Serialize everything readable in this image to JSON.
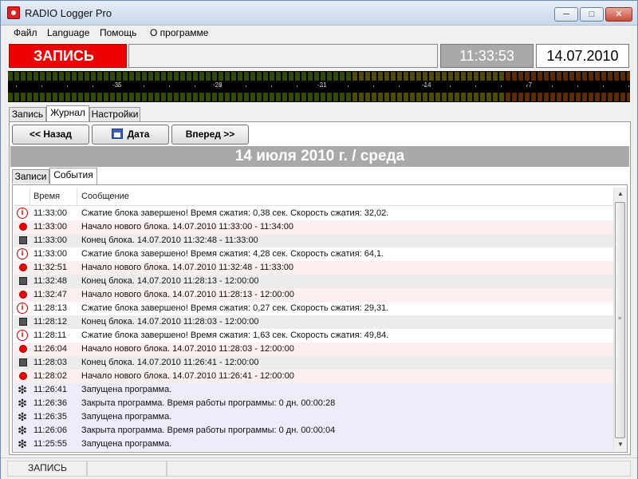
{
  "window": {
    "title": "RADIO Logger Pro"
  },
  "menu": [
    "Файл",
    "Language",
    "Помощь",
    "О программе"
  ],
  "status_strip": {
    "record_label": "ЗАПИСЬ",
    "time": "11:33:53",
    "date": "14.07.2010"
  },
  "meter": {
    "scale_labels": [
      "-35",
      "-28",
      "-21",
      "-14",
      "-7"
    ]
  },
  "top_tabs": [
    "Запись",
    "Журнал",
    "Настройки"
  ],
  "top_tabs_active": 1,
  "nav": {
    "back": "<< Назад",
    "date": "Дата",
    "forward": "Вперед >>"
  },
  "date_header": "14 июля 2010 г. / среда",
  "inner_tabs": [
    "Записи",
    "События"
  ],
  "inner_tabs_active": 1,
  "list": {
    "columns": [
      "Время",
      "Сообщение"
    ],
    "rows": [
      {
        "icon": "info-icon",
        "time": "11:33:00",
        "message": "Сжатие блока завершено! Время сжатия: 0,38 сек. Скорость сжатия: 32,02.",
        "bg": "#ffffff"
      },
      {
        "icon": "record-icon",
        "time": "11:33:00",
        "message": "Начало нового блока. 14.07.2010 11:33:00 - 11:34:00",
        "bg": "#fbefef"
      },
      {
        "icon": "stop-icon",
        "time": "11:33:00",
        "message": "Конец блока. 14.07.2010 11:32:48 - 11:33:00",
        "bg": "#ececec"
      },
      {
        "icon": "info-icon",
        "time": "11:33:00",
        "message": "Сжатие блока завершено! Время сжатия: 4,28 сек. Скорость сжатия: 64,1.",
        "bg": "#ffffff"
      },
      {
        "icon": "record-icon",
        "time": "11:32:51",
        "message": "Начало нового блока. 14.07.2010 11:32:48 - 11:33:00",
        "bg": "#fbefef"
      },
      {
        "icon": "stop-icon",
        "time": "11:32:48",
        "message": "Конец блока. 14.07.2010 11:28:13 - 12:00:00",
        "bg": "#ececec"
      },
      {
        "icon": "record-icon",
        "time": "11:32:47",
        "message": "Начало нового блока. 14.07.2010 11:28:13 - 12:00:00",
        "bg": "#fbefef"
      },
      {
        "icon": "info-icon",
        "time": "11:28:13",
        "message": "Сжатие блока завершено! Время сжатия: 0,27 сек. Скорость сжатия: 29,31.",
        "bg": "#ffffff"
      },
      {
        "icon": "stop-icon",
        "time": "11:28:12",
        "message": "Конец блока. 14.07.2010 11:28:03 - 12:00:00",
        "bg": "#ececec"
      },
      {
        "icon": "info-icon",
        "time": "11:28:11",
        "message": "Сжатие блока завершено! Время сжатия: 1,63 сек. Скорость сжатия: 49,84.",
        "bg": "#ffffff"
      },
      {
        "icon": "record-icon",
        "time": "11:26:04",
        "message": "Начало нового блока. 14.07.2010 11:28:03 - 12:00:00",
        "bg": "#fbefef"
      },
      {
        "icon": "stop-icon",
        "time": "11:28:03",
        "message": "Конец блока. 14.07.2010 11:26:41 - 12:00:00",
        "bg": "#ececec"
      },
      {
        "icon": "record-icon",
        "time": "11:28:02",
        "message": "Начало нового блока. 14.07.2010 11:26:41 - 12:00:00",
        "bg": "#fbefef"
      },
      {
        "icon": "program-icon",
        "time": "11:26:41",
        "message": "Запущена программа.",
        "bg": "#ecedf9"
      },
      {
        "icon": "program-icon",
        "time": "11:26:36",
        "message": "Закрыта программа. Время работы программы: 0 дн. 00:00:28",
        "bg": "#ecedf9"
      },
      {
        "icon": "program-icon",
        "time": "11:26:35",
        "message": "Запущена программа.",
        "bg": "#ecedf9"
      },
      {
        "icon": "program-icon",
        "time": "11:26:06",
        "message": "Закрыта программа. Время работы программы: 0 дн. 00:00:04",
        "bg": "#ecedf9"
      },
      {
        "icon": "program-icon",
        "time": "11:25:55",
        "message": "Запущена программа.",
        "bg": "#ecedf9"
      }
    ]
  },
  "statusbar": {
    "text": "ЗАПИСЬ"
  },
  "colors": {
    "record_red": "#ee0000",
    "header_gray": "#a9a9a9"
  }
}
